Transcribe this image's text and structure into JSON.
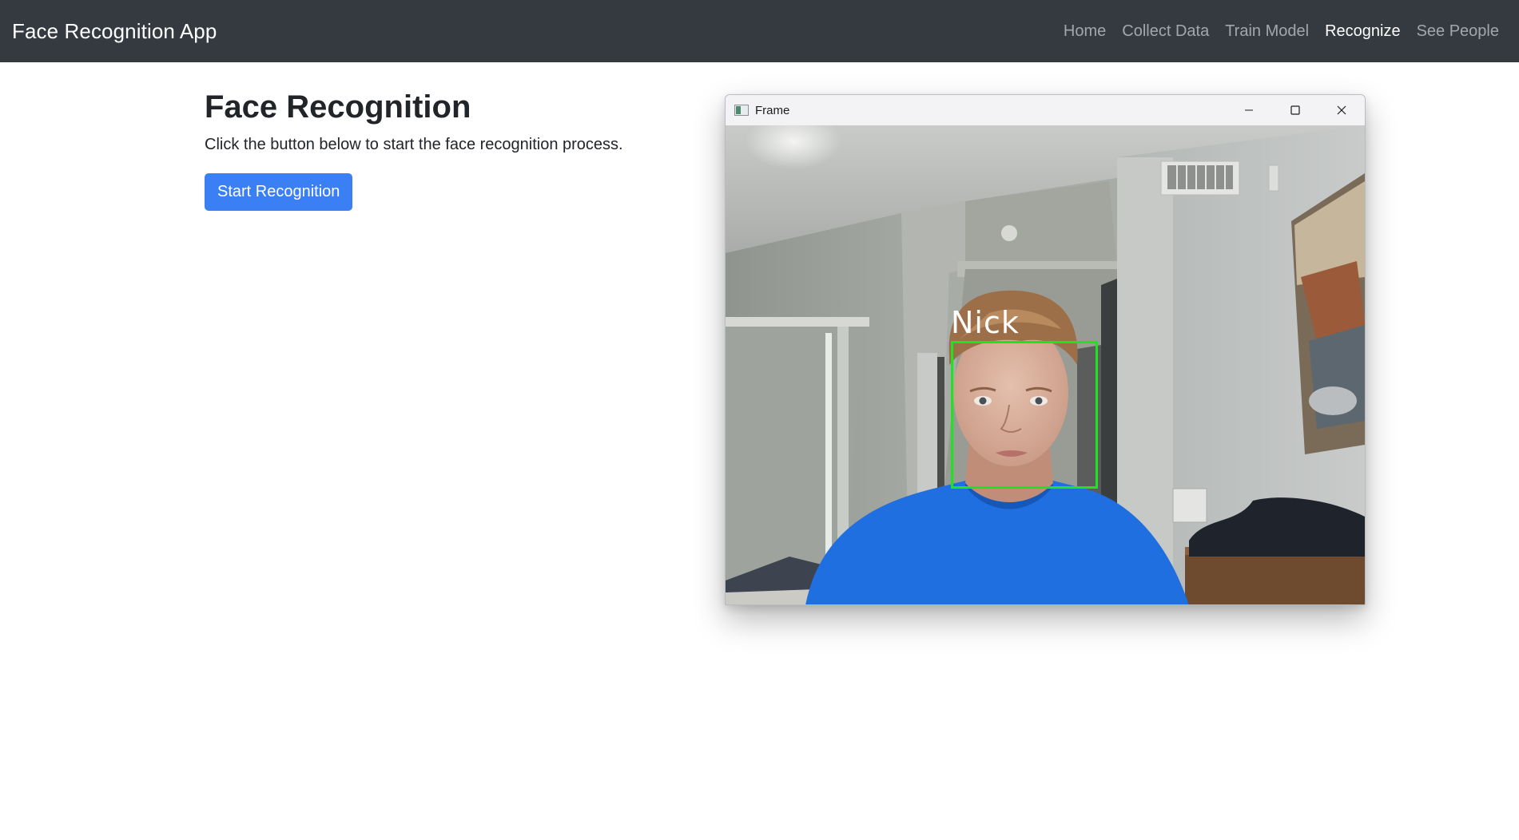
{
  "app": {
    "brand": "Face Recognition App"
  },
  "nav": {
    "items": [
      {
        "label": "Home",
        "active": false
      },
      {
        "label": "Collect Data",
        "active": false
      },
      {
        "label": "Train Model",
        "active": false
      },
      {
        "label": "Recognize",
        "active": true
      },
      {
        "label": "See People",
        "active": false
      }
    ]
  },
  "main": {
    "title": "Face Recognition",
    "description": "Click the button below to start the face recognition process.",
    "button_label": "Start Recognition"
  },
  "frame_window": {
    "title": "Frame",
    "detection_label": "Nick",
    "box_color": "#1fe31f"
  },
  "colors": {
    "navbar": "#343a40",
    "primary": "#3b7ff5"
  }
}
